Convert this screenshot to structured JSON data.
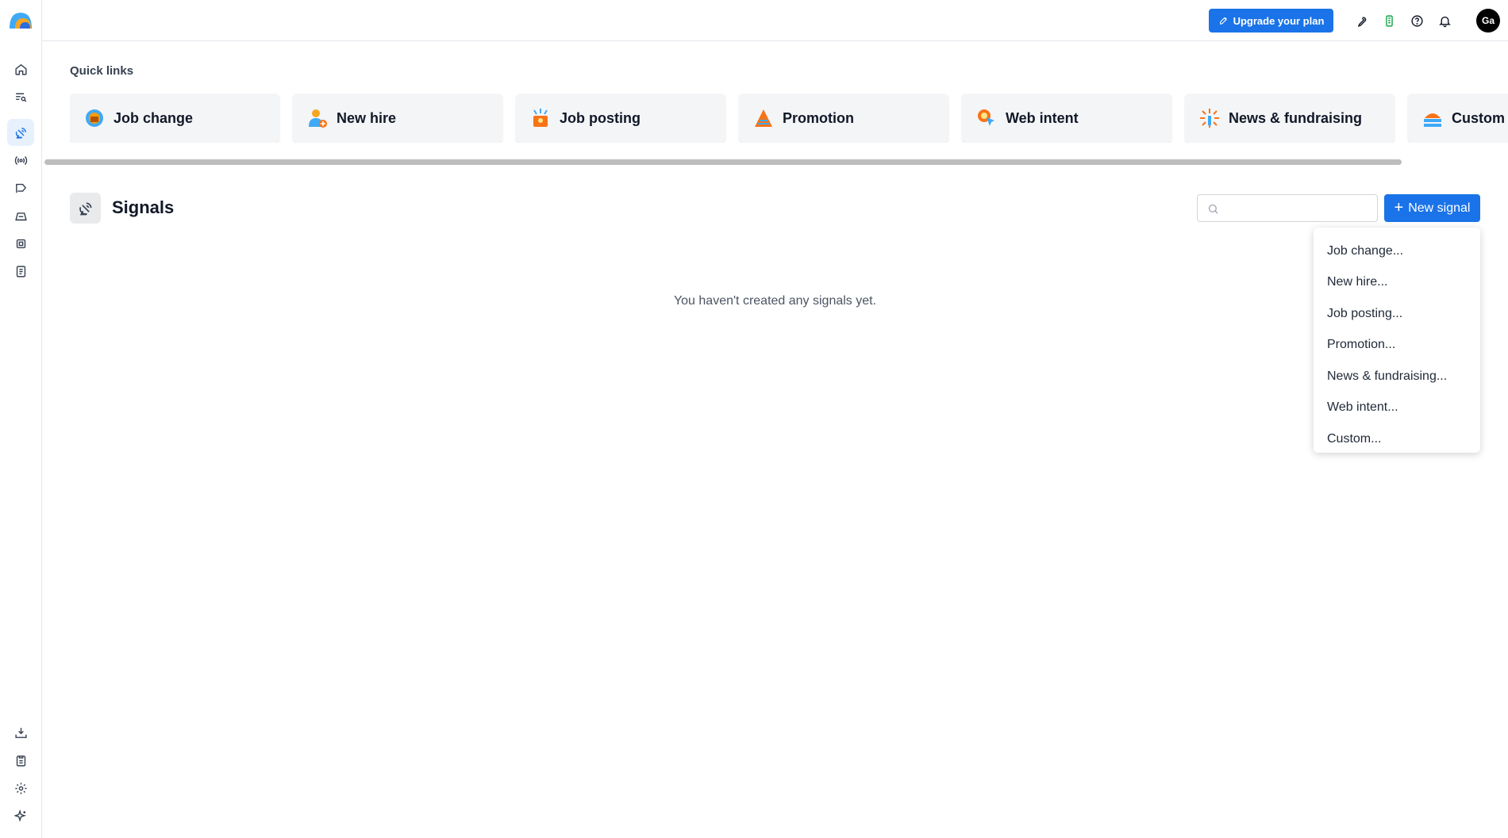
{
  "topbar": {
    "upgrade_label": "Upgrade your plan",
    "avatar_initials": "Ga"
  },
  "quick_links": {
    "title": "Quick links",
    "items": [
      {
        "label": "Job change",
        "icon": "job-change-icon"
      },
      {
        "label": "New hire",
        "icon": "new-hire-icon"
      },
      {
        "label": "Job posting",
        "icon": "job-posting-icon"
      },
      {
        "label": "Promotion",
        "icon": "promotion-icon"
      },
      {
        "label": "Web intent",
        "icon": "web-intent-icon"
      },
      {
        "label": "News & fundraising",
        "icon": "news-fundraising-icon"
      },
      {
        "label": "Custom",
        "icon": "custom-icon"
      }
    ]
  },
  "signals": {
    "title": "Signals",
    "search_placeholder": "",
    "new_button_label": "New signal",
    "empty_message": "You haven't created any signals yet."
  },
  "dropdown": {
    "items": [
      "Job change...",
      "New hire...",
      "Job posting...",
      "Promotion...",
      "News & fundraising...",
      "Web intent...",
      "Custom..."
    ]
  },
  "colors": {
    "accent": "#1a73e8",
    "active_nav_bg": "#e7f0fd",
    "card_bg": "#f4f5f7"
  }
}
